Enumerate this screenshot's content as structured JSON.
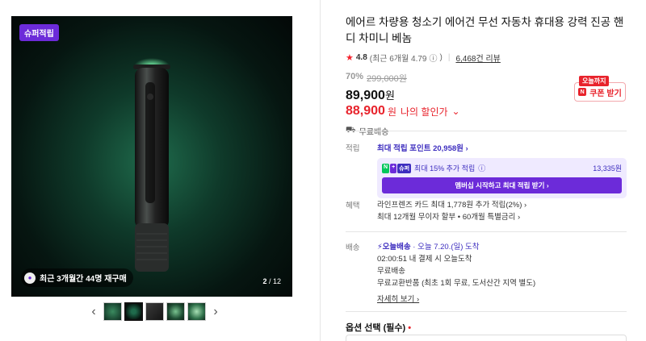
{
  "gallery": {
    "badge": "슈퍼적립",
    "buyers_text": "최근 3개월간 44명 재구매",
    "pager_current": "2",
    "pager_total": "/ 12",
    "prev": "‹",
    "next": "›"
  },
  "product": {
    "title": "에어르 차량용 청소기 에어건 무선 자동차 휴대용 강력 진공 핸디 차미니 베놈",
    "rating": "4.8",
    "rating_recent": "(최근 6개월 4.79",
    "info_icon": "ⓘ",
    "rating_recent_close": ")",
    "reviews": "6,468건 리뷰",
    "discount_pct": "70%",
    "original_price": "299,000원",
    "price_num": "89,900",
    "price_unit": "원",
    "my_price_num": "88,900",
    "my_price_unit": "원",
    "my_price_label": "나의 할인가",
    "shipping": "무료배송"
  },
  "coupon": {
    "tag": "오늘까지",
    "label": "쿠폰 받기"
  },
  "points": {
    "key": "적립",
    "max": "최대 적립 포인트 20,958원",
    "np_text": "최대 15% 추가 적립",
    "np_amount": "13,335원",
    "np_button": "멤버십 시작하고 최대 적립 받기 ›"
  },
  "benefits": {
    "key": "혜택",
    "line1": "라인프렌즈 카드 최대 1,778원 추가 적립(2%) ›",
    "line2": "최대 12개월 무이자 할부 • 60개월 특별금리 ›"
  },
  "delivery": {
    "key": "배송",
    "badge": "오늘배송",
    "date": "· 오늘 7.20.(일) 도착",
    "line1": "02:00:51  내 결제 시 오늘도착",
    "line2": "무료배송",
    "line3": "무료교환반품 (최초 1회 무료, 도서산간 지역 별도)",
    "more": "자세히 보기 ›"
  },
  "options": {
    "title": "옵션 선택 (필수)",
    "required_mark": "•"
  },
  "colors": {
    "accent": "#6c2bd9",
    "red": "#e8232c",
    "link": "#3d2dbf"
  }
}
